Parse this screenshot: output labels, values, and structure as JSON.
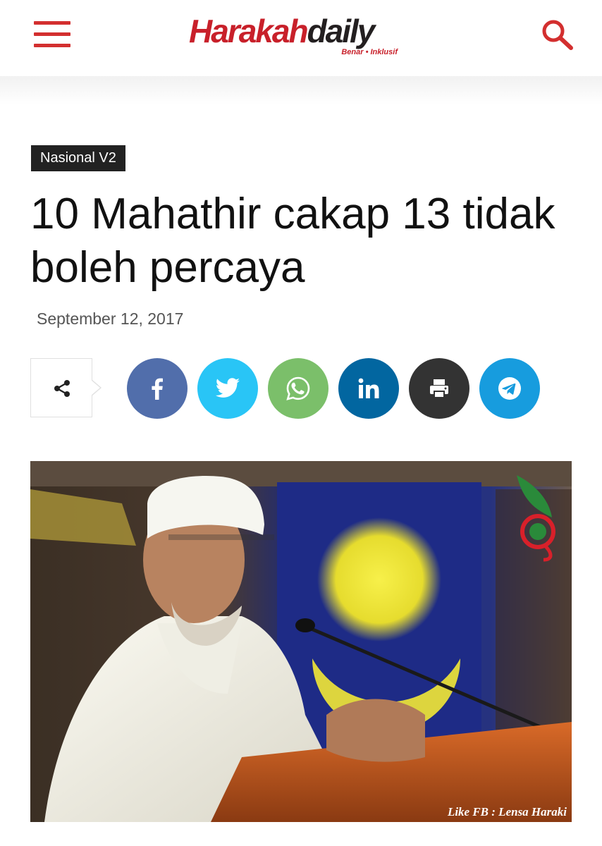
{
  "header": {
    "logo_part1": "Harakah",
    "logo_part2": "daily",
    "logo_tagline": "Benar • Inklusif",
    "brand_color": "#c8202a"
  },
  "article": {
    "category": "Nasional V2",
    "title": "10 Mahathir cakap 13 tidak boleh percaya",
    "date": "September 12, 2017"
  },
  "share": {
    "icons": [
      "share-icon",
      "facebook-icon",
      "twitter-icon",
      "whatsapp-icon",
      "linkedin-icon",
      "print-icon",
      "telegram-icon"
    ],
    "colors": {
      "facebook": "#516eab",
      "twitter": "#29c5f6",
      "whatsapp": "#7bbf6a",
      "linkedin": "#0266a0",
      "print": "#333333",
      "telegram": "#179cde"
    }
  },
  "image": {
    "caption": "Like FB : Lensa Haraki"
  }
}
